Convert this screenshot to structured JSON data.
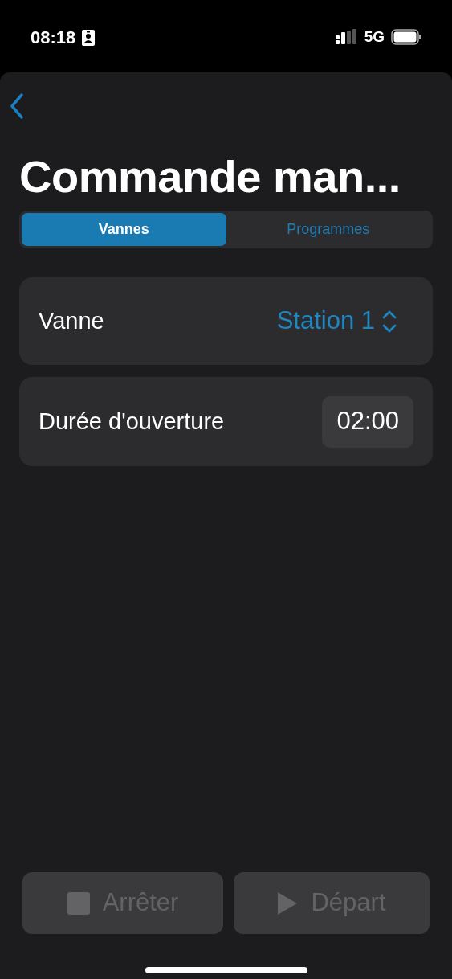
{
  "status_bar": {
    "time": "08:18",
    "network": "5G"
  },
  "title": "Commande man...",
  "tabs": [
    {
      "label": "Vannes",
      "selected": true
    },
    {
      "label": "Programmes",
      "selected": false
    }
  ],
  "rows": [
    {
      "kind": "picker",
      "label": "Vanne",
      "value": "Station 1"
    },
    {
      "kind": "duration",
      "label": "Durée d'ouverture",
      "value": "02:00"
    }
  ],
  "buttons": [
    {
      "kind": "stop",
      "label": "Arrêter",
      "disabled": true
    },
    {
      "kind": "play",
      "label": "Départ",
      "disabled": true
    }
  ]
}
